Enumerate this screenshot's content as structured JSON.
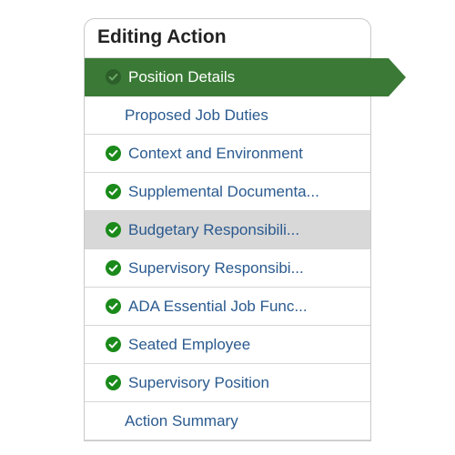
{
  "panel": {
    "title": "Editing Action",
    "items": [
      {
        "label": "Position Details",
        "has_check": true,
        "state": "active"
      },
      {
        "label": "Proposed Job Duties",
        "has_check": false,
        "state": ""
      },
      {
        "label": "Context and Environment",
        "has_check": true,
        "state": ""
      },
      {
        "label": "Supplemental Documenta...",
        "has_check": true,
        "state": ""
      },
      {
        "label": "Budgetary Responsibili...",
        "has_check": true,
        "state": "hover"
      },
      {
        "label": "Supervisory Responsibi...",
        "has_check": true,
        "state": ""
      },
      {
        "label": "ADA Essential Job Func...",
        "has_check": true,
        "state": ""
      },
      {
        "label": "Seated Employee",
        "has_check": true,
        "state": ""
      },
      {
        "label": "Supervisory Position",
        "has_check": true,
        "state": ""
      },
      {
        "label": "Action Summary",
        "has_check": false,
        "state": ""
      }
    ]
  }
}
